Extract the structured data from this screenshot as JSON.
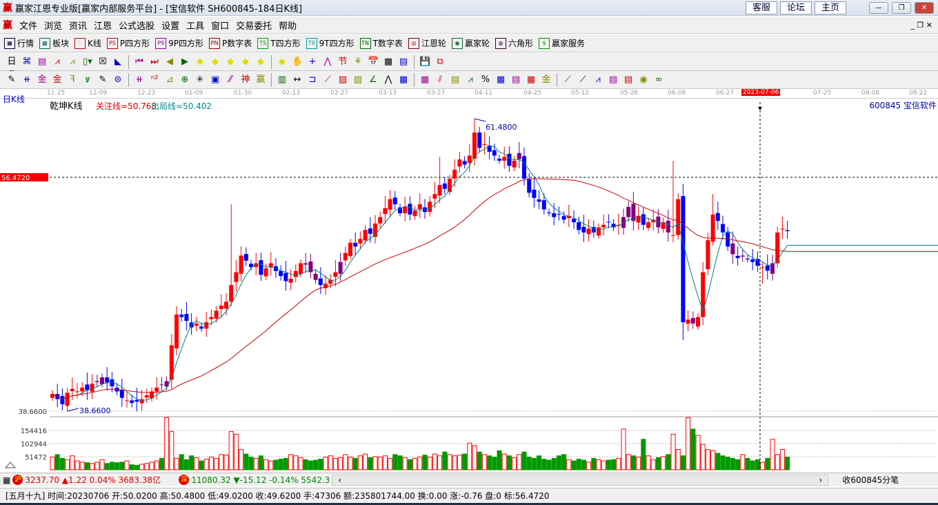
{
  "window": {
    "title": "赢家江恩专业版[赢家内部服务平台] - [宝信软件  SH600845-184日K线]",
    "logo": "赢",
    "links": [
      "客服",
      "论坛",
      "主页"
    ]
  },
  "menu": [
    "文件",
    "浏览",
    "资讯",
    "江恩",
    "公式选股",
    "设置",
    "工具",
    "窗口",
    "交易委托",
    "帮助"
  ],
  "toolbar1": [
    {
      "icon": "grid-icon",
      "badge": "▦",
      "label": "行情",
      "color": "#003"
    },
    {
      "icon": "blocks-icon",
      "badge": "▩",
      "label": "板块",
      "color": "#066"
    },
    {
      "icon": "kline-icon",
      "badge": "⫶",
      "label": "K线",
      "color": "#c00"
    },
    {
      "icon": "ps-icon",
      "badge": "PS",
      "label": "P四方形",
      "color": "#c00"
    },
    {
      "icon": "p9-icon",
      "badge": "P9",
      "label": "9P四方形",
      "color": "#909"
    },
    {
      "icon": "pn-icon",
      "badge": "PN",
      "label": "P数字表",
      "color": "#900"
    },
    {
      "icon": "ts-icon",
      "badge": "TS",
      "label": "T四方形",
      "color": "#090"
    },
    {
      "icon": "t9-icon",
      "badge": "T9",
      "label": "9T四方形",
      "color": "#099"
    },
    {
      "icon": "tn-icon",
      "badge": "TN",
      "label": "T数字表",
      "color": "#060"
    },
    {
      "icon": "gann-wheel-icon",
      "badge": "◎",
      "label": "江恩轮",
      "color": "#800"
    },
    {
      "icon": "winner-wheel-icon",
      "badge": "◉",
      "label": "赢家轮",
      "color": "#063"
    },
    {
      "icon": "hexagon-icon",
      "badge": "◍",
      "label": "六角形",
      "color": "#303"
    },
    {
      "icon": "dollar-icon",
      "badge": "$",
      "label": "赢家服务",
      "color": "#080"
    }
  ],
  "toolbar2": [
    "日▾",
    "⌘",
    "▤",
    "⩘",
    "⩘",
    "▯▾",
    "☒",
    "◣",
    "⏮",
    "⏭",
    "◀",
    "▶",
    "◆",
    "◆",
    "◆",
    "◆",
    "◆",
    "◆",
    "✋",
    "+",
    "⋀",
    "节",
    "⚘",
    "📅",
    "▦",
    "▤",
    "💾",
    "⧉"
  ],
  "toolbar3": [
    "✎",
    "⧺",
    "金",
    "金",
    "ꟻ",
    "ꝟ",
    "✎",
    "⊜",
    "⧺",
    "ⁿ²",
    "⊿",
    "⊕",
    "✳",
    "▣",
    "⁄⁄",
    "神",
    "赢",
    "▥",
    "↔",
    "⊐",
    "⟋",
    "▨",
    "▨",
    "∠",
    "⋀",
    "▦",
    "▦",
    "⫽",
    "▤",
    "⩘",
    "%",
    "▦",
    "▤",
    "▦",
    "金",
    "⟋",
    "⟋",
    "⩘",
    "▤",
    "▤",
    "◉",
    "∞"
  ],
  "dates": [
    "11-25",
    "12-09",
    "12-23",
    "01-09",
    "01-30",
    "02-13",
    "02-27",
    "03-13",
    "03-27",
    "04-11",
    "04-25",
    "05-12",
    "05-26",
    "06-09",
    "06-27",
    "2023-07-06",
    "07-25",
    "08-08",
    "08-22"
  ],
  "chart": {
    "period": "日K线",
    "indicator": "乾坤K线",
    "focus_label": "关注线=50.768",
    "exit_label": "出局线=50.402",
    "stock": "600845  宝信软件",
    "price_marker": "56.4720",
    "high_label": "61.4800",
    "low_label": "38.6600",
    "low_axis": "38.6600",
    "vol_axis": [
      "154416",
      "102944",
      "51472"
    ],
    "colors": {
      "up": "#ff0000",
      "down": "#0000ff",
      "highlight": "#800080",
      "ma_short": "#008080",
      "ma_long": "#d00000"
    }
  },
  "chart_data": {
    "type": "candlestick",
    "ylim": [
      38.66,
      61.48
    ],
    "selected_index": 144,
    "closes": [
      40.0,
      39.6,
      39.2,
      40.1,
      40.4,
      40.2,
      40.5,
      40.3,
      40.8,
      41.0,
      41.3,
      40.9,
      40.6,
      40.2,
      39.7,
      39.5,
      39.3,
      39.4,
      39.6,
      39.9,
      40.2,
      40.5,
      40.7,
      41.0,
      43.8,
      46.2,
      46.0,
      45.7,
      45.2,
      45.5,
      45.1,
      45.6,
      46.0,
      46.5,
      46.9,
      47.2,
      48.5,
      49.5,
      50.8,
      50.4,
      49.9,
      50.2,
      49.3,
      49.8,
      50.2,
      49.6,
      49.2,
      48.8,
      49.0,
      49.6,
      50.2,
      50.1,
      49.5,
      48.9,
      48.5,
      48.6,
      48.9,
      49.5,
      50.3,
      51.0,
      51.8,
      51.5,
      52.1,
      52.8,
      52.5,
      53.3,
      53.8,
      54.5,
      55.2,
      54.8,
      54.1,
      54.6,
      54.0,
      54.3,
      54.8,
      54.2,
      55.0,
      55.6,
      56.3,
      56.0,
      56.8,
      57.5,
      58.3,
      57.9,
      58.6,
      60.4,
      59.2,
      59.5,
      58.9,
      58.6,
      58.2,
      58.5,
      57.8,
      58.2,
      58.8,
      56.8,
      55.7,
      55.3,
      55.0,
      54.4,
      54.1,
      53.8,
      54.0,
      53.6,
      53.9,
      53.4,
      52.8,
      52.6,
      52.9,
      52.6,
      53.0,
      53.2,
      53.4,
      53.0,
      53.2,
      53.8,
      54.6,
      53.5,
      53.9,
      53.2,
      53.4,
      53.6,
      53.0,
      53.4,
      52.6,
      52.4,
      55.2,
      45.6,
      45.8,
      45.5,
      46.0,
      49.5,
      52.0,
      54.0,
      53.5,
      52.6,
      51.5,
      50.9,
      50.6,
      50.8,
      50.5,
      50.3,
      50.0,
      49.9,
      49.62,
      50.2,
      52.6,
      52.9,
      52.7
    ],
    "high_overrides": {
      "85": 61.48,
      "125": 58.2,
      "133": 55.6,
      "36": 54.8,
      "78": 58.5
    },
    "low_overrides": {
      "3": 38.66,
      "127": 44.2,
      "143": 48.6
    },
    "highlight_indices": [
      9,
      10,
      22,
      23,
      51,
      52,
      53,
      58,
      94,
      115,
      116,
      117,
      122,
      124,
      129,
      137,
      139,
      145
    ],
    "volumes_thousands": [
      50,
      60,
      45,
      40,
      55,
      35,
      30,
      28,
      25,
      30,
      40,
      25,
      30,
      28,
      30,
      35,
      20,
      18,
      22,
      25,
      30,
      35,
      45,
      205,
      150,
      45,
      60,
      40,
      55,
      48,
      35,
      42,
      50,
      45,
      60,
      58,
      150,
      140,
      80,
      62,
      50,
      45,
      55,
      40,
      35,
      38,
      42,
      45,
      60,
      55,
      48,
      40,
      35,
      38,
      42,
      50,
      55,
      45,
      48,
      60,
      50,
      45,
      55,
      62,
      48,
      52,
      50,
      55,
      45,
      60,
      55,
      48,
      40,
      45,
      50,
      58,
      50,
      62,
      55,
      70,
      60,
      55,
      58,
      62,
      105,
      95,
      70,
      60,
      55,
      50,
      75,
      62,
      55,
      48,
      60,
      70,
      50,
      45,
      55,
      42,
      38,
      45,
      55,
      60,
      40,
      35,
      42,
      38,
      30,
      45,
      40,
      35,
      38,
      40,
      45,
      160,
      60,
      55,
      50,
      120,
      55,
      40,
      48,
      52,
      60,
      140,
      80,
      55,
      205,
      160,
      135,
      100,
      80,
      75,
      65,
      55,
      50,
      45,
      40,
      60,
      45,
      35,
      40,
      30,
      45,
      120,
      60,
      80,
      50
    ]
  },
  "index_bar": {
    "sh_badge": "沪",
    "sh_text": "3237.70 ▲1.22 0.04% 3683.38亿",
    "sz_badge": "深",
    "sz_text": "11080.32 ▼-15.12 -0.14% 5542.38",
    "right": "收600845分笔"
  },
  "status": "[五月十九] 时间:20230706 开:50.0200 高:50.4800 低:49.0200 收:49.6200 手:47306 额:235801744.00 换:0.00 涨:-0.76 盘:0 标:56.4720"
}
